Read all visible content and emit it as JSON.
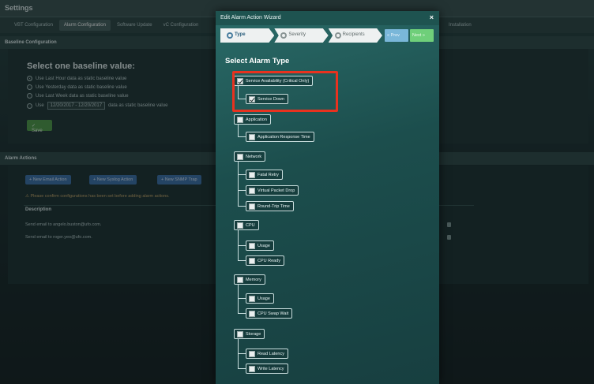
{
  "background": {
    "settings_title": "Settings",
    "tabs": [
      {
        "label": "VBT Configuration",
        "active": false
      },
      {
        "label": "Alarm Configuration",
        "active": true
      },
      {
        "label": "Software Update",
        "active": false
      },
      {
        "label": "vC Configuration",
        "active": false
      }
    ],
    "tab_extra": "Installation",
    "baseline_section": "Baseline Configuration",
    "baseline_title": "Select one baseline value:",
    "baseline_options": [
      {
        "label": "Use Last Hour data as static baseline value",
        "selected": true
      },
      {
        "label": "Use Yesterday data as static baseline value",
        "selected": false
      },
      {
        "label": "Use Last Week data as static baseline value",
        "selected": false
      }
    ],
    "custom_range": {
      "prefix": "Use",
      "value": "12/20/2017 - 12/20/2017",
      "suffix": "data as static baseline value"
    },
    "save_button": "✓ Save",
    "alarm_section": "Alarm Actions",
    "action_buttons": [
      "+ New Email Action",
      "+ New Syslog Action",
      "+ New SNMP Trap"
    ],
    "warning": "⚠ Please confirm configurations has been set before adding alarm actions.",
    "description_header": "Description",
    "description_rows": [
      "Send email to angelo.buston@ufo.com.",
      "Send email to roger.yeo@ufo.com."
    ]
  },
  "modal": {
    "title": "Edit Alarm Action Wizard",
    "close_icon": "×",
    "steps": [
      {
        "label": "Type",
        "active": true
      },
      {
        "label": "Severity",
        "active": false
      },
      {
        "label": "Recipients",
        "active": false
      }
    ],
    "prev_label": "« Prev",
    "next_label": "Next »",
    "heading": "Select Alarm Type",
    "groups": [
      {
        "label": "Service Availability (Critical Only)",
        "checked": true,
        "children": [
          {
            "label": "Service Down",
            "checked": true
          }
        ]
      },
      {
        "label": "Application",
        "checked": false,
        "children": [
          {
            "label": "Application Response Time",
            "checked": false
          }
        ]
      },
      {
        "label": "Network",
        "checked": false,
        "children": [
          {
            "label": "Fatal Retry",
            "checked": false
          },
          {
            "label": "Virtual Packet Drop",
            "checked": false
          },
          {
            "label": "Round-Trip Time",
            "checked": false
          }
        ]
      },
      {
        "label": "CPU",
        "checked": false,
        "children": [
          {
            "label": "Usage",
            "checked": false
          },
          {
            "label": "CPU Ready",
            "checked": false
          }
        ]
      },
      {
        "label": "Memory",
        "checked": false,
        "children": [
          {
            "label": "Usage",
            "checked": false
          },
          {
            "label": "CPU Swap Wait",
            "checked": false
          }
        ]
      },
      {
        "label": "Storage",
        "checked": false,
        "children": [
          {
            "label": "Read Latency",
            "checked": false
          },
          {
            "label": "Write Latency",
            "checked": false
          }
        ]
      }
    ],
    "highlight_color": "#e8321f"
  }
}
